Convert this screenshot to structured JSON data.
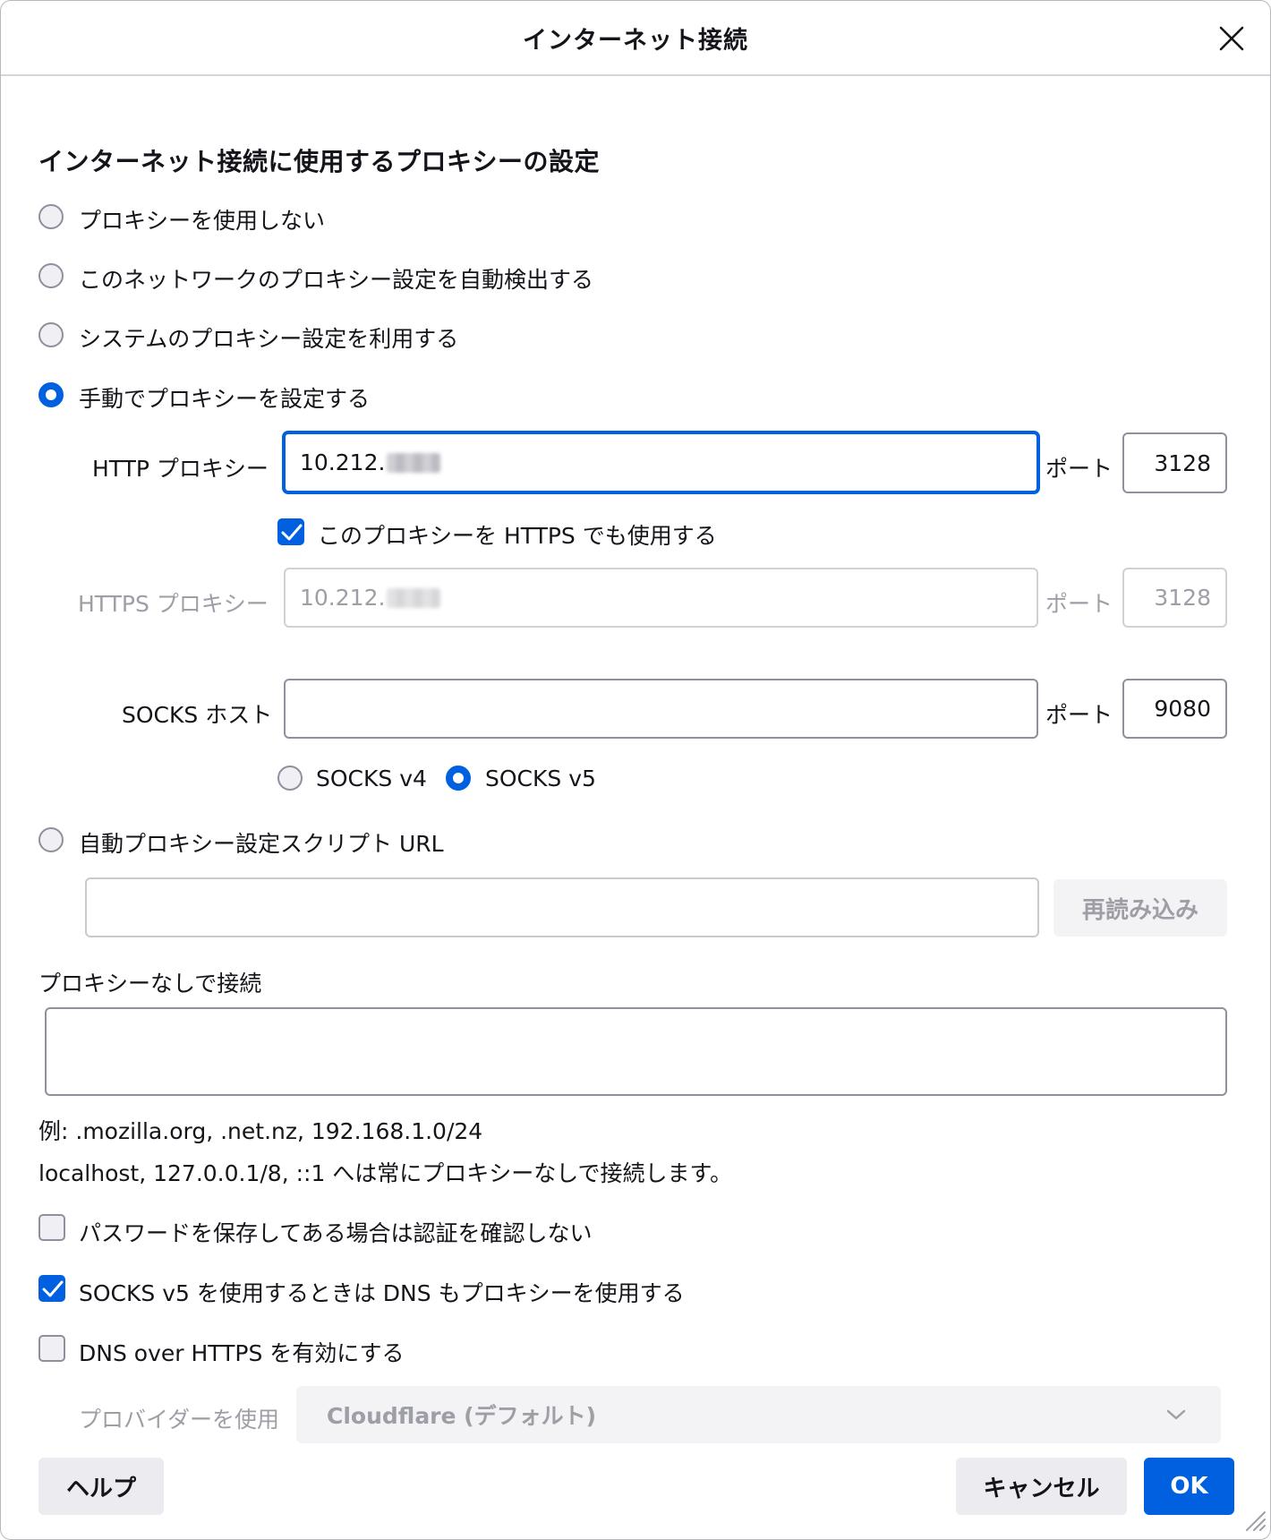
{
  "dialog": {
    "title": "インターネット接続",
    "heading": "インターネット接続に使用するプロキシーの設定"
  },
  "proxy_modes": [
    {
      "label": "プロキシーを使用しない",
      "selected": false
    },
    {
      "label": "このネットワークのプロキシー設定を自動検出する",
      "selected": false
    },
    {
      "label": "システムのプロキシー設定を利用する",
      "selected": false
    },
    {
      "label": "手動でプロキシーを設定する",
      "selected": true
    }
  ],
  "http": {
    "label": "HTTP プロキシー",
    "value": "10.212.",
    "port_label": "ポート",
    "port": "3128"
  },
  "use_for_https": {
    "label": "このプロキシーを HTTPS でも使用する",
    "checked": true
  },
  "https": {
    "label": "HTTPS プロキシー",
    "value": "10.212.",
    "port_label": "ポート",
    "port": "3128"
  },
  "socks": {
    "label": "SOCKS ホスト",
    "value": "",
    "port_label": "ポート",
    "port": "9080",
    "v4_label": "SOCKS v4",
    "v5_label": "SOCKS v5",
    "selected": "SOCKS v5"
  },
  "auto_url": {
    "label": "自動プロキシー設定スクリプト URL",
    "selected": false,
    "value": "",
    "reload_label": "再読み込み"
  },
  "no_proxy": {
    "label": "プロキシーなしで接続",
    "value": "",
    "example": "例: .mozilla.org, .net.nz, 192.168.1.0/24",
    "note": "localhost, 127.0.0.1/8, ::1 へは常にプロキシーなしで接続します。"
  },
  "options": [
    {
      "label": "パスワードを保存してある場合は認証を確認しない",
      "checked": false
    },
    {
      "label": "SOCKS v5 を使用するときは DNS もプロキシーを使用する",
      "checked": true
    },
    {
      "label": "DNS over HTTPS を有効にする",
      "checked": false
    }
  ],
  "provider": {
    "label": "プロバイダーを使用",
    "selected": "Cloudflare (デフォルト)"
  },
  "buttons": {
    "help": "ヘルプ",
    "cancel": "キャンセル",
    "ok": "OK"
  },
  "colors": {
    "accent": "#0060df",
    "border": "#8f8f9d",
    "disabled_text": "#9e9ea6"
  }
}
